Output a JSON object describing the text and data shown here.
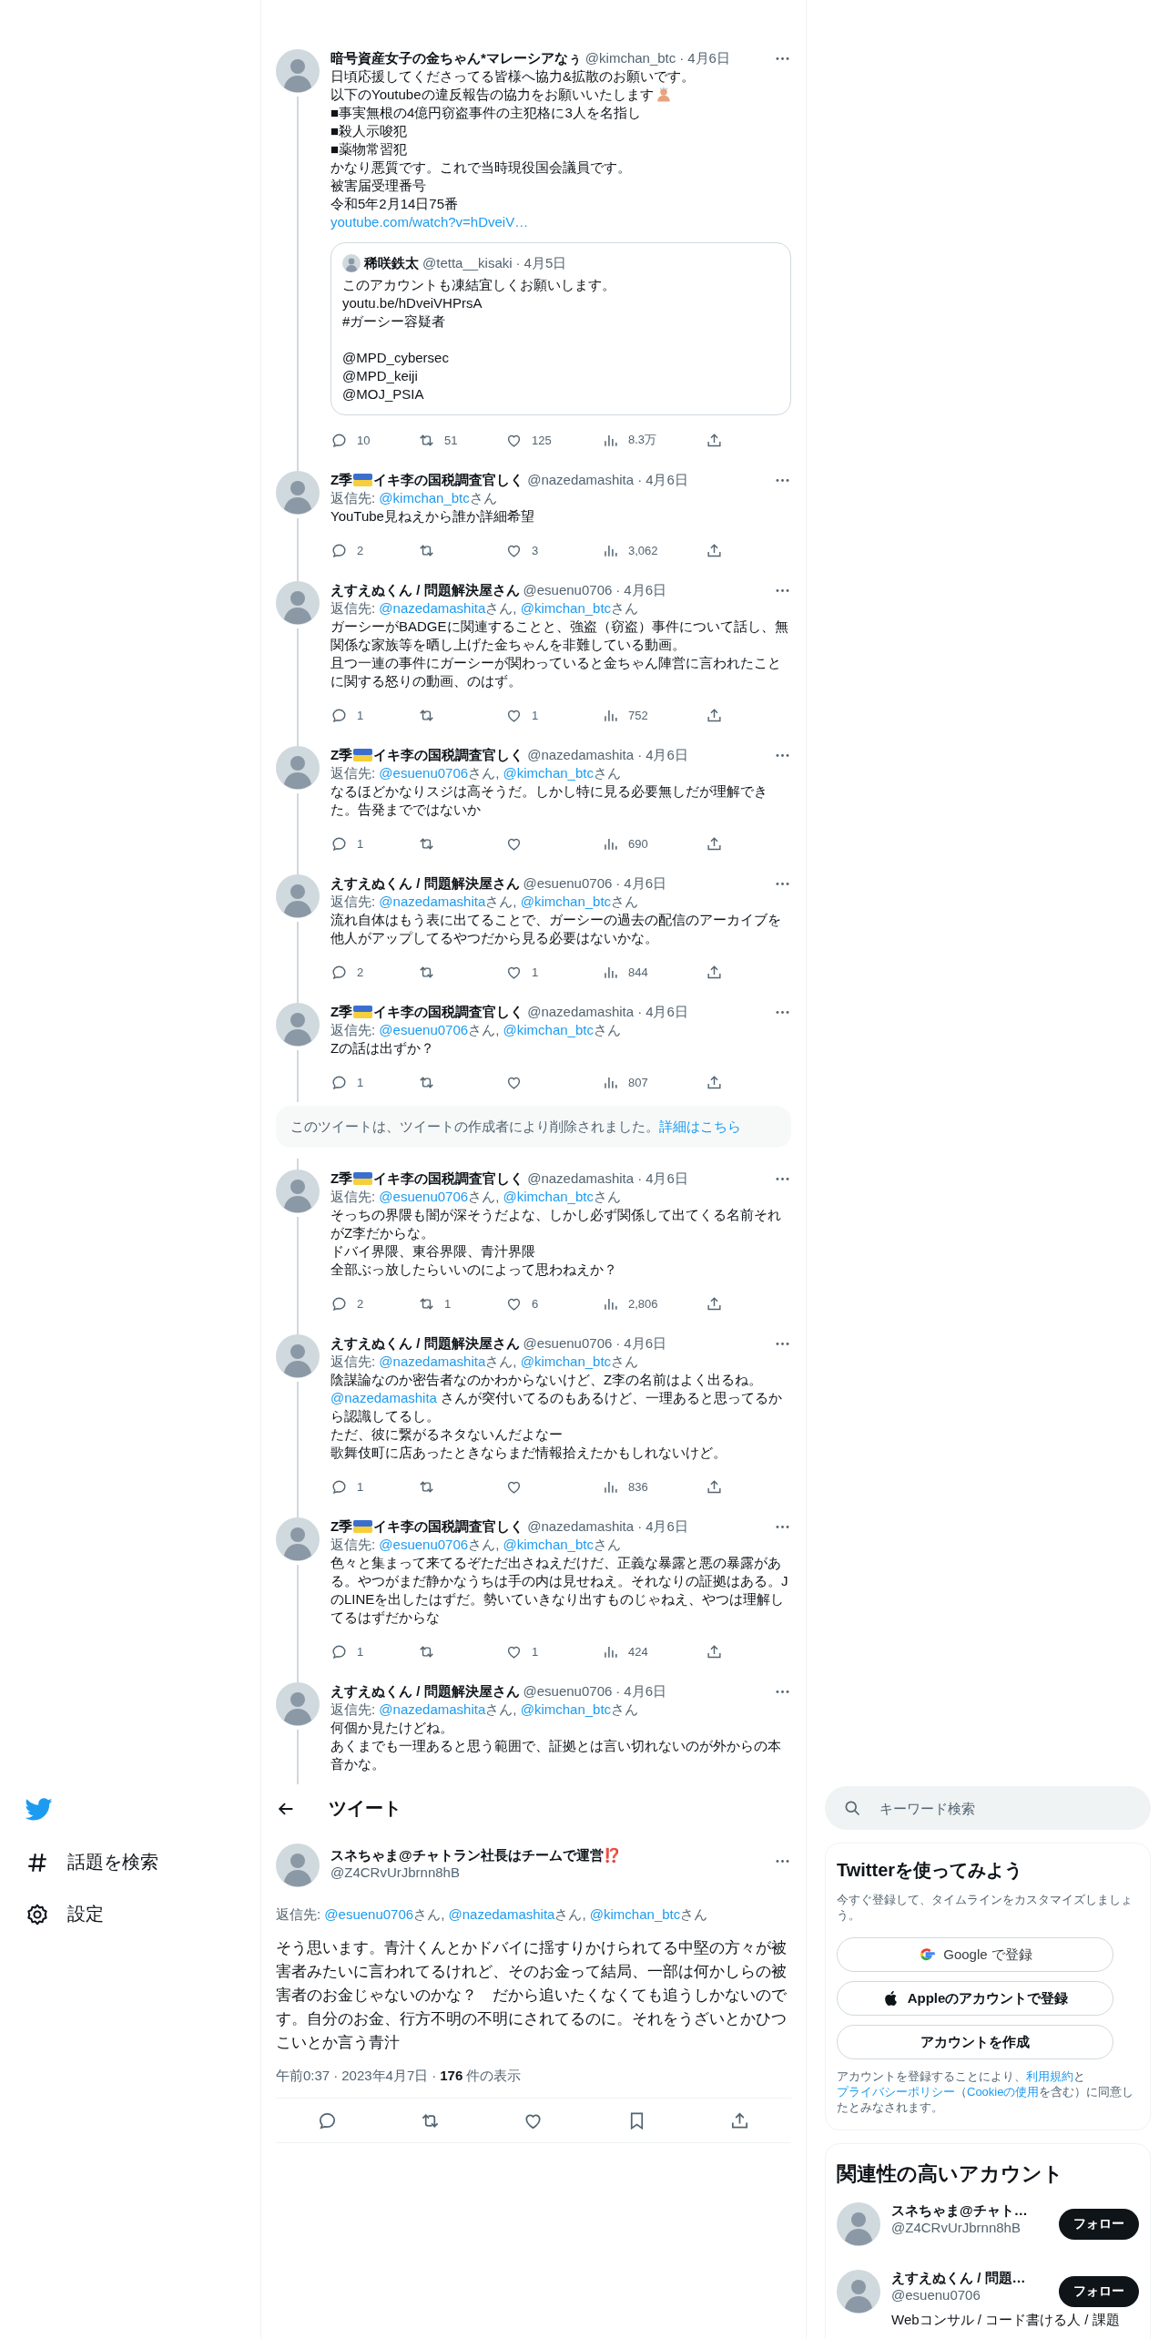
{
  "thread": [
    {
      "kind": "tweet",
      "name": [
        {
          "text": "暗号資産女子の金ちゃん*マレーシアなぅ"
        }
      ],
      "handle": "@kimchan_btc",
      "dot": "·",
      "date": "4月6日",
      "body": [
        "日頃応援してくださってる皆様へ協力&拡散のお願いです。",
        {
          "kind": "emoji",
          "text": "以下のYoutubeの違反報告の協力をお願いいたします"
        },
        "■事実無根の4億円窃盗事件の主犯格に3人を名指し",
        "■殺人示唆犯",
        "■薬物常習犯",
        "かなり悪質です。これで当時現役国会議員です。",
        "被害届受理番号",
        "令和5年2月14日75番",
        {
          "kind": "link",
          "text": "youtube.com/watch?v=hDveiV…"
        }
      ],
      "quote": {
        "name": "稀咲鉄太",
        "handle": "@tetta__kisaki",
        "dot": "·",
        "date": "4月5日",
        "blocks": [
          [
            "このアカウントも凍結宜しくお願いします。",
            "youtu.be/hDveiVHPrsA",
            "#ガーシー容疑者"
          ],
          [
            "@MPD_cybersec",
            "@MPD_keiji",
            "@MOJ_PSIA"
          ]
        ]
      },
      "stats": {
        "replies": "10",
        "retweets": "51",
        "likes": "125",
        "views": "8.3万"
      }
    },
    {
      "kind": "tweet",
      "name": [
        {
          "text": "Z季"
        },
        {
          "kind": "flag"
        },
        {
          "text": "イキ李の国税調査官しく"
        }
      ],
      "handle": "@nazedamashita",
      "dot": "·",
      "date": "4月6日",
      "reply_to": {
        "label": "返信先:",
        "mentions": [
          {
            "handle": "@kimchan_btc",
            "after": "さん"
          }
        ]
      },
      "body": [
        "YouTube見ねえから誰か詳細希望"
      ],
      "stats": {
        "replies": "2",
        "likes": "3",
        "views": "3,062"
      }
    },
    {
      "kind": "tweet",
      "name": [
        {
          "text": "えすえぬくん / 問題解決屋さん"
        }
      ],
      "handle": "@esuenu0706",
      "dot": "·",
      "date": "4月6日",
      "reply_to": {
        "label": "返信先:",
        "mentions": [
          {
            "handle": "@nazedamashita",
            "after": "さん,"
          },
          {
            "handle": "@kimchan_btc",
            "after": "さん"
          }
        ]
      },
      "body": [
        "ガーシーがBADGEに関連することと、強盗（窃盗）事件について話し、無関係な家族等を晒し上げた金ちゃんを非難している動画。",
        "且つ一連の事件にガーシーが関わっていると金ちゃん陣営に言われたことに関する怒りの動画、のはず。"
      ],
      "stats": {
        "replies": "1",
        "likes": "1",
        "views": "752"
      }
    },
    {
      "kind": "tweet",
      "name": [
        {
          "text": "Z季"
        },
        {
          "kind": "flag"
        },
        {
          "text": "イキ李の国税調査官しく"
        }
      ],
      "handle": "@nazedamashita",
      "dot": "·",
      "date": "4月6日",
      "reply_to": {
        "label": "返信先:",
        "mentions": [
          {
            "handle": "@esuenu0706",
            "after": "さん,"
          },
          {
            "handle": "@kimchan_btc",
            "after": "さん"
          }
        ]
      },
      "body": [
        "なるほどかなりスジは高そうだ。しかし特に見る必要無しだが理解できた。告発までではないか"
      ],
      "stats": {
        "replies": "1",
        "views": "690"
      }
    },
    {
      "kind": "tweet",
      "name": [
        {
          "text": "えすえぬくん / 問題解決屋さん"
        }
      ],
      "handle": "@esuenu0706",
      "dot": "·",
      "date": "4月6日",
      "reply_to": {
        "label": "返信先:",
        "mentions": [
          {
            "handle": "@nazedamashita",
            "after": "さん,"
          },
          {
            "handle": "@kimchan_btc",
            "after": "さん"
          }
        ]
      },
      "body": [
        "流れ自体はもう表に出てることで、ガーシーの過去の配信のアーカイブを他人がアップしてるやつだから見る必要はないかな。"
      ],
      "stats": {
        "replies": "2",
        "likes": "1",
        "views": "844"
      }
    },
    {
      "kind": "tweet",
      "name": [
        {
          "text": "Z季"
        },
        {
          "kind": "flag"
        },
        {
          "text": "イキ李の国税調査官しく"
        }
      ],
      "handle": "@nazedamashita",
      "dot": "·",
      "date": "4月6日",
      "reply_to": {
        "label": "返信先:",
        "mentions": [
          {
            "handle": "@esuenu0706",
            "after": "さん,"
          },
          {
            "handle": "@kimchan_btc",
            "after": "さん"
          }
        ]
      },
      "body": [
        "Zの話は出ずか？"
      ],
      "stats": {
        "replies": "1",
        "views": "807"
      }
    },
    {
      "kind": "notice",
      "text": "このツイートは、ツイートの作成者により削除されました。",
      "link": "詳細はこちら"
    },
    {
      "kind": "tweet",
      "name": [
        {
          "text": "Z季"
        },
        {
          "kind": "flag"
        },
        {
          "text": "イキ李の国税調査官しく"
        }
      ],
      "handle": "@nazedamashita",
      "dot": "·",
      "date": "4月6日",
      "reply_to": {
        "label": "返信先:",
        "mentions": [
          {
            "handle": "@esuenu0706",
            "after": "さん,"
          },
          {
            "handle": "@kimchan_btc",
            "after": "さん"
          }
        ]
      },
      "body": [
        "そっちの界隈も闇が深そうだよな、しかし必ず関係して出てくる名前それがZ李だからな。",
        "ドバイ界隈、東谷界隈、青汁界隈",
        "全部ぶっ放したらいいのによって思わねえか？"
      ],
      "stats": {
        "replies": "2",
        "retweets": "1",
        "likes": "6",
        "views": "2,806"
      }
    },
    {
      "kind": "tweet",
      "name": [
        {
          "text": "えすえぬくん / 問題解決屋さん"
        }
      ],
      "handle": "@esuenu0706",
      "dot": "·",
      "date": "4月6日",
      "reply_to": {
        "label": "返信先:",
        "mentions": [
          {
            "handle": "@nazedamashita",
            "after": "さん,"
          },
          {
            "handle": "@kimchan_btc",
            "after": "さん"
          }
        ]
      },
      "body": [
        "陰謀論なのか密告者なのかわからないけど、Z李の名前はよく出るね。",
        {
          "kind": "mention",
          "mention": "@nazedamashita",
          "text": " さんが突付いてるのもあるけど、一理あると思ってるから認識してるし。"
        },
        "ただ、彼に繋がるネタないんだよなー",
        "歌舞伎町に店あったときならまだ情報拾えたかもしれないけど。"
      ],
      "stats": {
        "replies": "1",
        "views": "836"
      }
    },
    {
      "kind": "tweet",
      "name": [
        {
          "text": "Z季"
        },
        {
          "kind": "flag"
        },
        {
          "text": "イキ李の国税調査官しく"
        }
      ],
      "handle": "@nazedamashita",
      "dot": "·",
      "date": "4月6日",
      "reply_to": {
        "label": "返信先:",
        "mentions": [
          {
            "handle": "@esuenu0706",
            "after": "さん,"
          },
          {
            "handle": "@kimchan_btc",
            "after": "さん"
          }
        ]
      },
      "body": [
        "色々と集まって来てるぞただ出さねえだけだ、正義な暴露と悪の暴露がある。やつがまだ静かなうちは手の内は見せねえ。それなりの証拠はある。JのLINEを出したはずだ。勢いていきなり出すものじゃねえ、やつは理解してるはずだからな"
      ],
      "stats": {
        "replies": "1",
        "likes": "1",
        "views": "424"
      }
    },
    {
      "kind": "tweet",
      "name": [
        {
          "text": "えすえぬくん / 問題解決屋さん"
        }
      ],
      "handle": "@esuenu0706",
      "dot": "·",
      "date": "4月6日",
      "reply_to": {
        "label": "返信先:",
        "mentions": [
          {
            "handle": "@nazedamashita",
            "after": "さん,"
          },
          {
            "handle": "@kimchan_btc",
            "after": "さん"
          }
        ]
      },
      "body": [
        "何個か見たけどね。",
        "あくまでも一理あると思う範囲で、証拠とは言い切れないのが外からの本音かな。"
      ]
    }
  ],
  "nav": {
    "items": [
      {
        "kind": "hashtag",
        "label": "話題を検索"
      },
      {
        "kind": "gear",
        "label": "設定"
      }
    ]
  },
  "header": {
    "title": "ツイート"
  },
  "focal": {
    "name": [
      {
        "text": "スネちゃま@チャトラン社長はチームで運営⁉️"
      }
    ],
    "handle": "@Z4CRvUrJbrnn8hB",
    "reply_to": {
      "label": "返信先:",
      "mentions": [
        {
          "handle": "@esuenu0706",
          "after": "さん,"
        },
        {
          "handle": "@nazedamashita",
          "after": "さん,"
        },
        {
          "handle": "@kimchan_btc",
          "after": "さん"
        }
      ]
    },
    "text": "そう思います。青汁くんとかドバイに揺すりかけられてる中堅の方々が被害者みたいに言われてるけれど、そのお金って結局、一部は何かしらの被害者のお金じゃないのかな？　だから追いたくなくても追うしかないのです。自分のお金、行方不明の不明にされてるのに。それをうざいとかひつこいとか言う青汁",
    "time": "午前0:37",
    "dot": "·",
    "date": "2023年4月7日",
    "dot2": "·",
    "views_count": "176",
    "views_label": "件の表示"
  },
  "search": {
    "placeholder": "キーワード検索"
  },
  "signup": {
    "title": "Twitterを使ってみよう",
    "subtitle": "今すぐ登録して、タイムラインをカスタマイズしましょう。",
    "buttons": [
      {
        "kind": "google",
        "label": "Google で登録"
      },
      {
        "kind": "apple",
        "label": "Appleのアカウントで登録"
      },
      {
        "kind": "plain",
        "label": "アカウントを作成"
      }
    ],
    "legal": [
      {
        "kind": "text",
        "text": "アカウントを登録することにより、"
      },
      {
        "kind": "link",
        "text": "利用規約"
      },
      {
        "kind": "text",
        "text": "と"
      },
      {
        "kind": "link",
        "text": "プライバシーポリシー"
      },
      {
        "kind": "text",
        "text": "（"
      },
      {
        "kind": "link",
        "text": "Cookieの使用"
      },
      {
        "kind": "text",
        "text": "を含む）に同意したとみなされます。"
      }
    ]
  },
  "related": {
    "title": "関連性の高いアカウント",
    "accounts": [
      {
        "name": "スネちゃま@チャト…",
        "handle": "@Z4CRvUrJbrnn8hB",
        "button": "フォロー"
      },
      {
        "name": "えすえぬくん / 問題…",
        "handle": "@esuenu0706",
        "button": "フォロー",
        "bio": "Webコンサル / コード書ける人 / 課題"
      }
    ]
  }
}
